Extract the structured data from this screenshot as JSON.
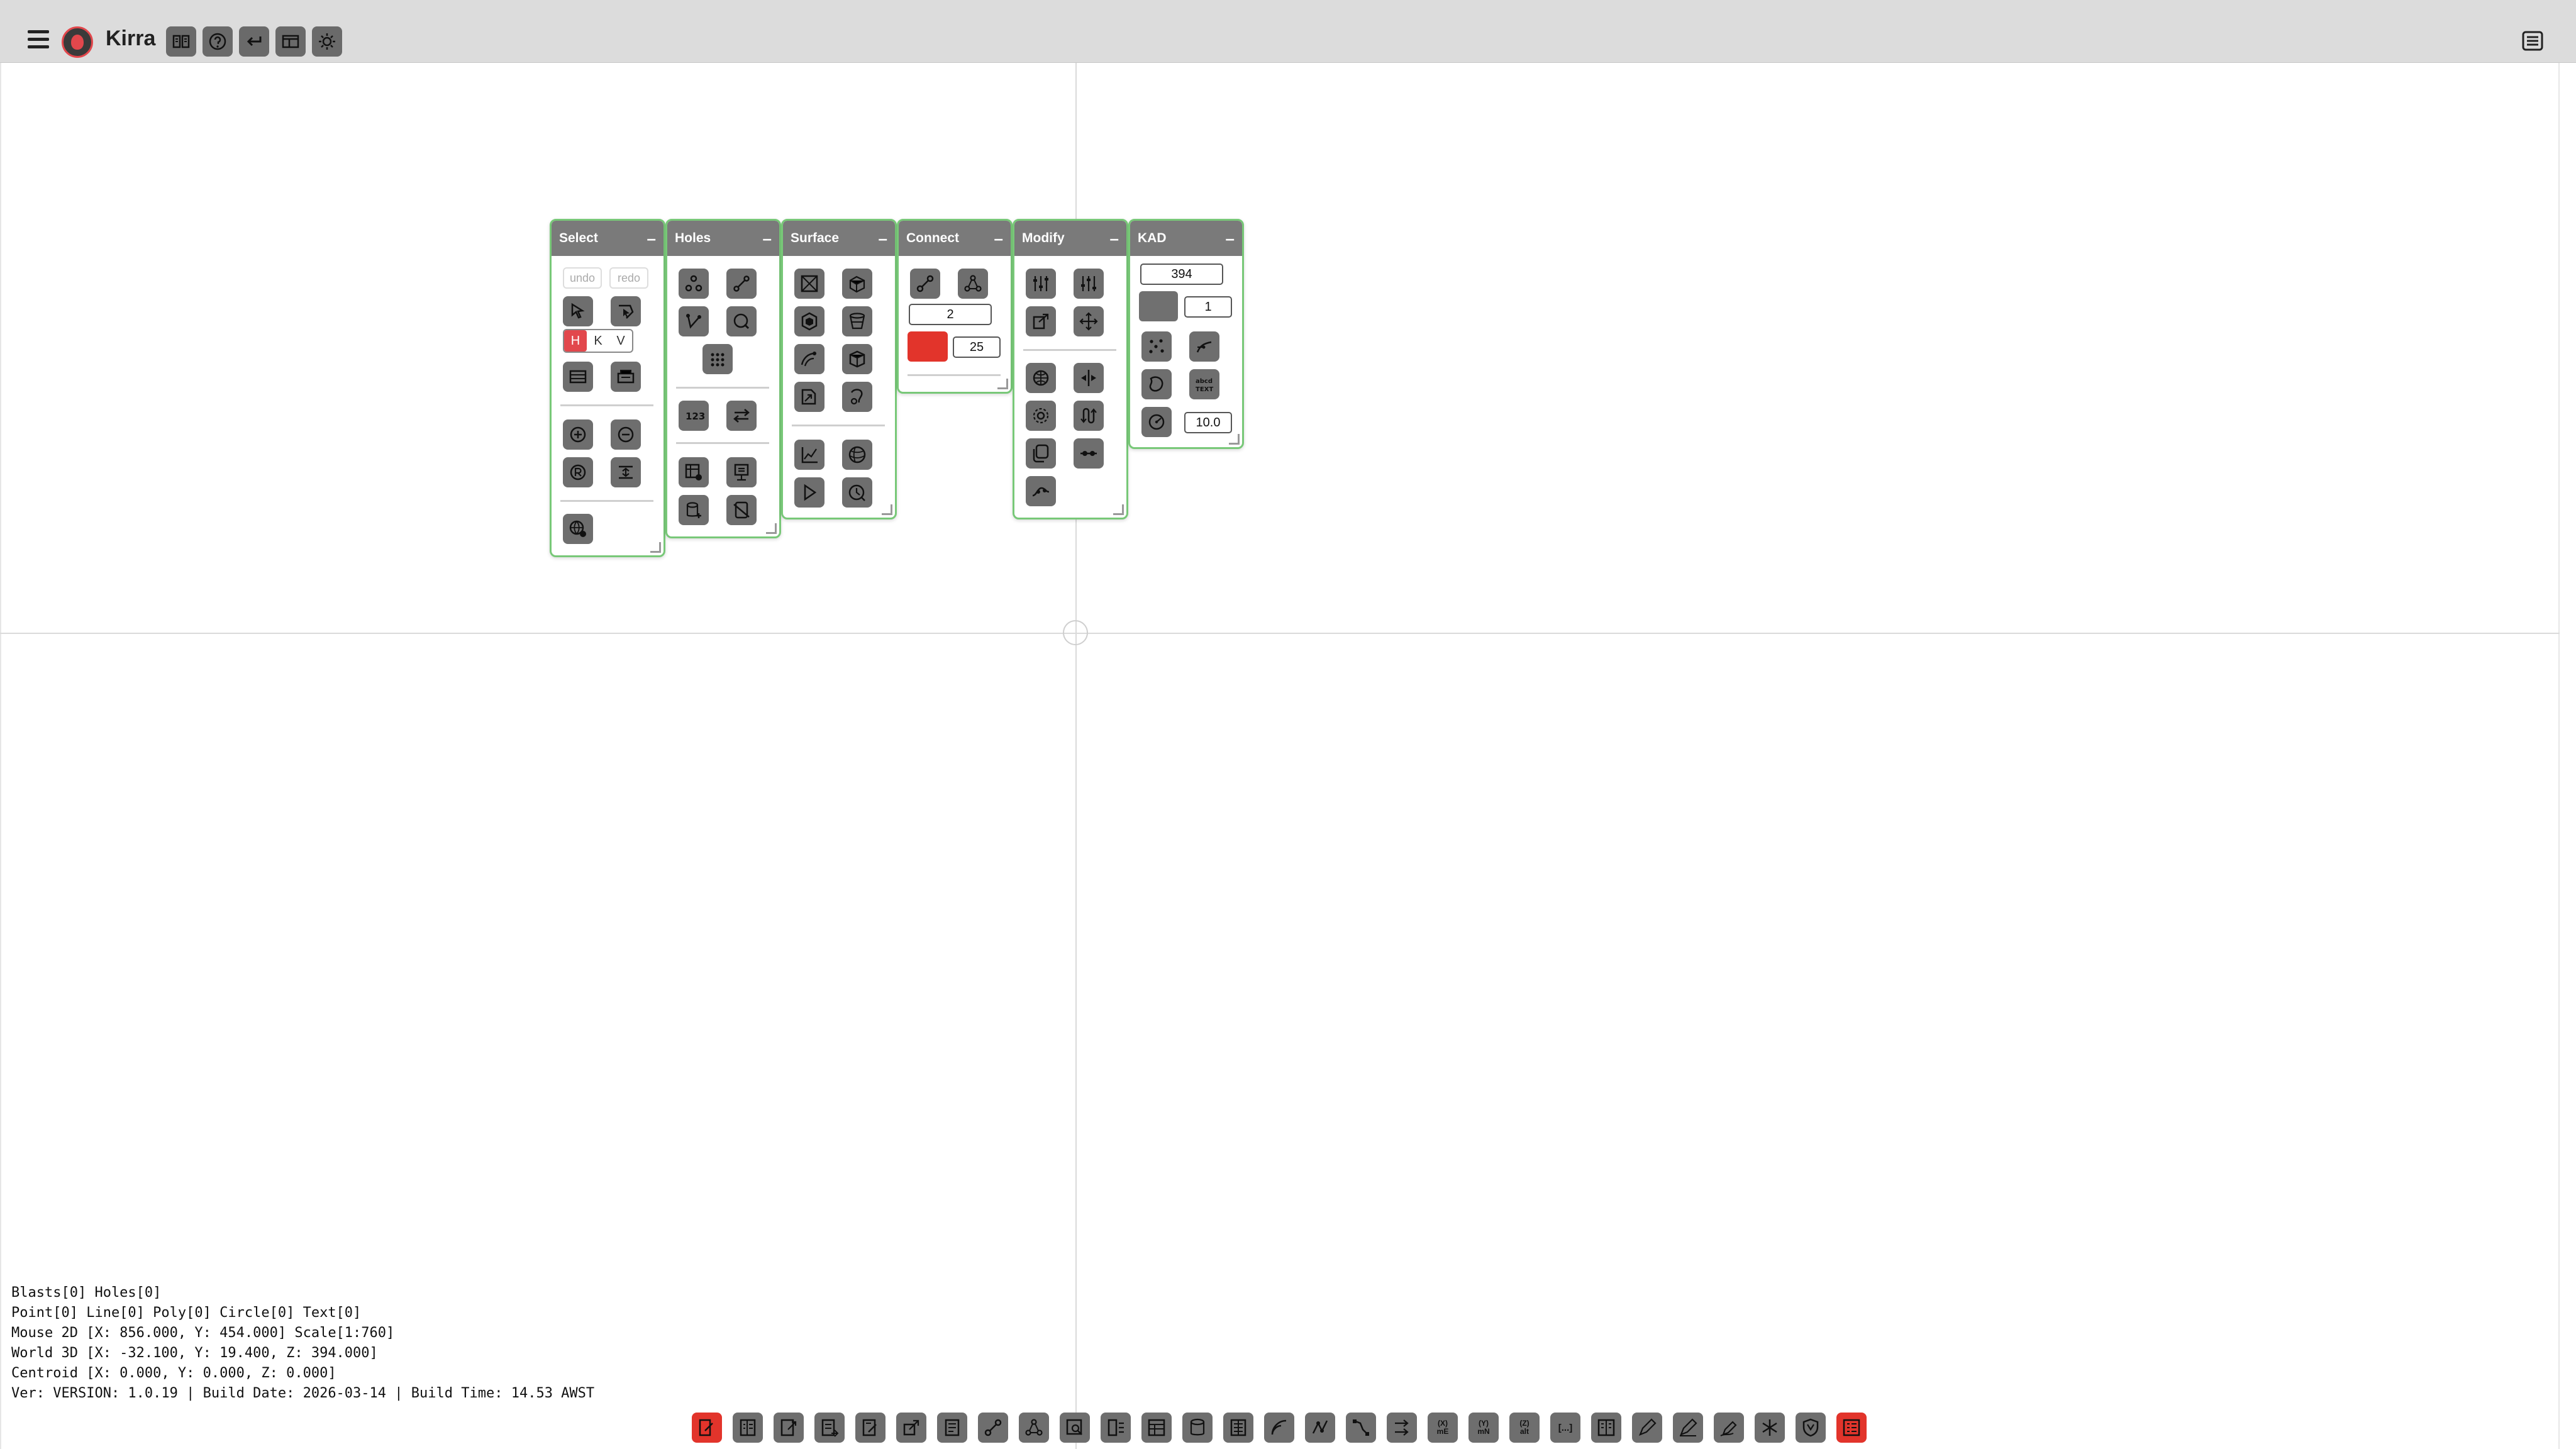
{
  "header": {
    "title": "Kirra",
    "buttons": [
      "book-icon",
      "help-icon",
      "undo-arrow-icon",
      "layout-icon",
      "sun-icon"
    ]
  },
  "panels": {
    "select": {
      "title": "Select",
      "undo_label": "undo",
      "redo_label": "redo",
      "toggle": [
        "H",
        "K",
        "V"
      ],
      "active_toggle": "H"
    },
    "holes": {
      "title": "Holes"
    },
    "surface": {
      "title": "Surface"
    },
    "connect": {
      "title": "Connect",
      "count_value": "2",
      "color": "#e2342b",
      "size_value": "25"
    },
    "modify": {
      "title": "Modify"
    },
    "kad": {
      "title": "KAD",
      "elevation_value": "394",
      "color": "#707070",
      "line_width_value": "1",
      "radius_value": "10.0"
    }
  },
  "status": {
    "line1": "Blasts[0] Holes[0]",
    "line2": "Point[0] Line[0] Poly[0] Circle[0] Text[0]",
    "line3": "Mouse 2D [X: 856.000, Y: 454.000] Scale[1:760]",
    "line4": "World 3D [X: -32.100, Y: 19.400, Z: 394.000]",
    "line5": "Centroid [X: 0.000, Y: 0.000, Z: 0.000]",
    "line6": "Ver: VERSION: 1.0.19 | Build Date: 2026-03-14 | Build Time: 14.53 AWST"
  },
  "bottom_toolbar": {
    "labeled": {
      "me": "(X)\nmE",
      "mn": "(Y)\nmN",
      "alt": "(Z)\nalt",
      "brackets": "[...]"
    },
    "accent": "#e2342b"
  }
}
